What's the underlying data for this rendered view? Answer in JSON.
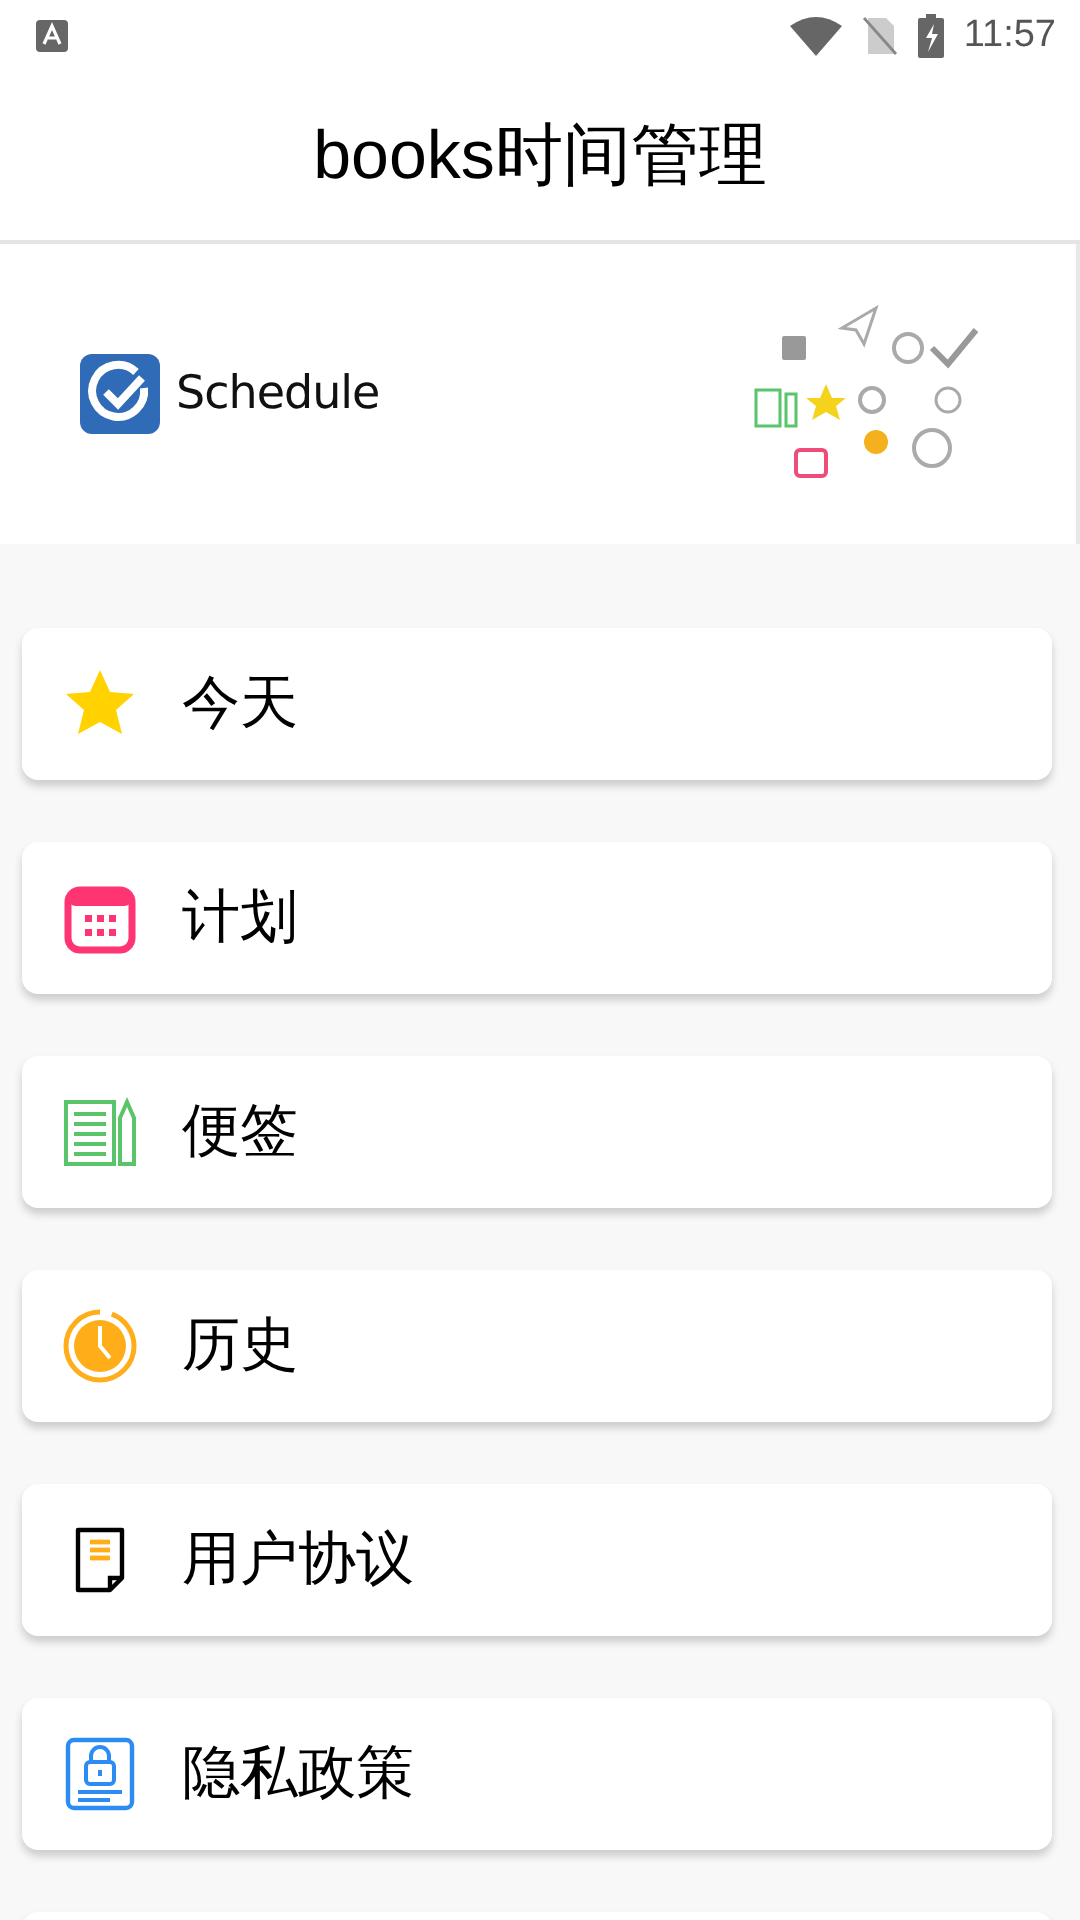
{
  "status_bar": {
    "time": "11:57"
  },
  "app_bar": {
    "title": "books时间管理"
  },
  "banner": {
    "logo_text": "Schedule"
  },
  "menu": [
    {
      "kind": "star",
      "label": "今天"
    },
    {
      "kind": "calendar",
      "label": "计划"
    },
    {
      "kind": "notes",
      "label": "便签"
    },
    {
      "kind": "clock",
      "label": "历史"
    },
    {
      "kind": "document",
      "label": "用户协议"
    },
    {
      "kind": "lock",
      "label": "隐私政策"
    }
  ]
}
